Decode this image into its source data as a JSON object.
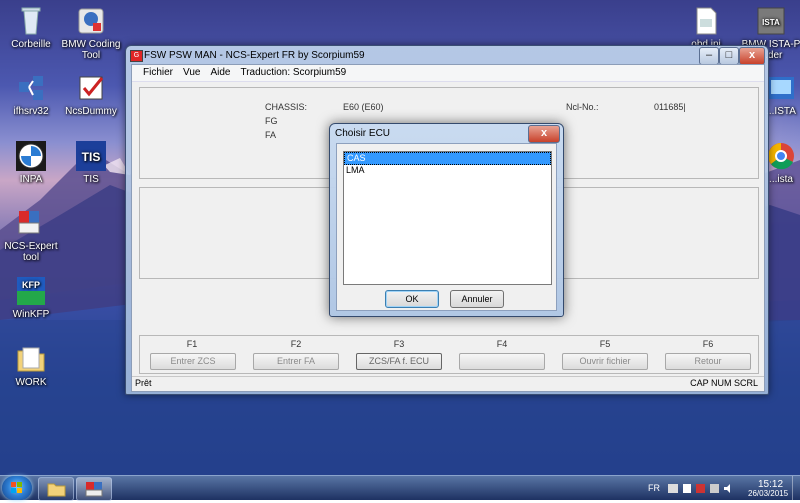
{
  "desktop": {
    "icons_left": [
      {
        "label": "Corbeille",
        "icon": "recycle-bin-icon"
      },
      {
        "label": "BMW Coding Tool",
        "icon": "bmw-coding-tool-icon"
      },
      {
        "label": "ifhsrv32",
        "icon": "network-icon"
      },
      {
        "label": "NcsDummy",
        "icon": "checkmark-app-icon"
      },
      {
        "label": "INPA",
        "icon": "bmw-logo-icon"
      },
      {
        "label": "TIS",
        "icon": "tis-icon"
      },
      {
        "label": "NCS-Expert tool",
        "icon": "ncs-expert-icon"
      },
      {
        "label": "WinKFP",
        "icon": "kfp-icon"
      },
      {
        "label": "WORK",
        "icon": "folder-icon"
      }
    ],
    "icons_right": [
      {
        "label": "obd.ini",
        "icon": "ini-file-icon"
      },
      {
        "label": "BMW ISTA-P ...der",
        "icon": "ista-p-icon"
      },
      {
        "label": "...ISTA",
        "icon": "ista-icon"
      },
      {
        "label": "...ista",
        "icon": "chrome-icon"
      }
    ]
  },
  "window": {
    "title": "FSW PSW MAN - NCS-Expert FR by Scorpium59",
    "app_icon_text": "G",
    "controls": {
      "minimize": "–",
      "maximize": "□",
      "close": "x"
    },
    "menu": [
      "Fichier",
      "Vue",
      "Aide",
      "Traduction: Scorpium59"
    ],
    "info": {
      "chassis_label": "CHASSIS:",
      "chassis_value": "E60 (E60)",
      "fg_label": "FG",
      "fa_label": "FA",
      "ncl_label": "Ncl-No.:",
      "ncl_value": "011685|"
    },
    "function_keys": [
      {
        "key": "F1",
        "label": "Entrer ZCS",
        "active": false
      },
      {
        "key": "F2",
        "label": "Entrer FA",
        "active": false
      },
      {
        "key": "F3",
        "label": "ZCS/FA f. ECU",
        "active": true
      },
      {
        "key": "F4",
        "label": "",
        "active": false
      },
      {
        "key": "F5",
        "label": "Ouvrir fichier",
        "active": false
      },
      {
        "key": "F6",
        "label": "Retour",
        "active": false
      }
    ],
    "status": {
      "left": "Prêt",
      "right": "CAP  NUM  SCRL"
    }
  },
  "dialog": {
    "title": "Choisir ECU",
    "close": "x",
    "list": [
      {
        "label": "CAS",
        "selected": true
      },
      {
        "label": "LMA",
        "selected": false
      }
    ],
    "ok": "OK",
    "cancel": "Annuler"
  },
  "taskbar": {
    "language": "FR",
    "time": "15:12",
    "date": "26/03/2015"
  },
  "colors": {
    "selection": "#3399ff",
    "close_button": "#c8412a",
    "desktop_deep": "#1d3a85"
  }
}
